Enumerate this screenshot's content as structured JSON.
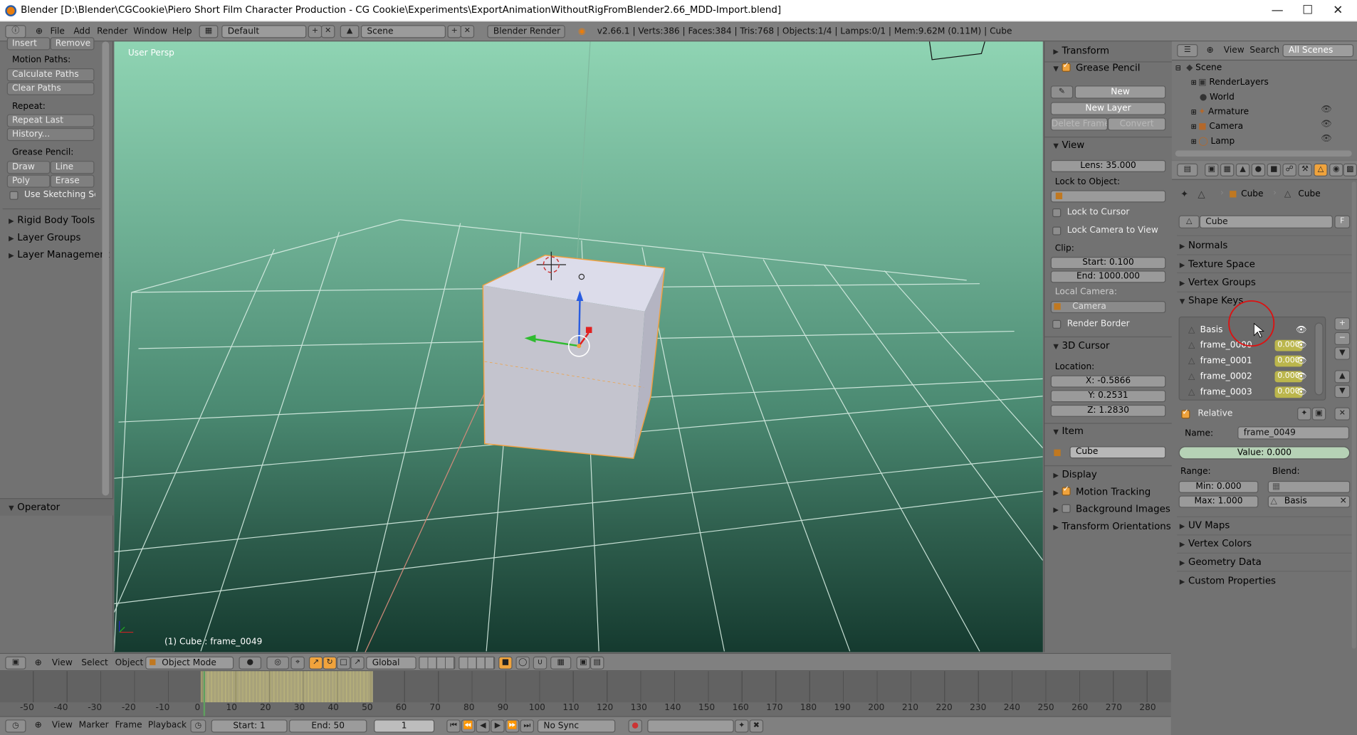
{
  "window": {
    "title": "Blender [D:\\Blender\\CGCookie\\Piero Short Film Character Production - CG Cookie\\Experiments\\ExportAnimationWithoutRigFromBlender2.66_MDD-Import.blend]"
  },
  "info_header": {
    "menus": [
      "File",
      "Add",
      "Render",
      "Window",
      "Help"
    ],
    "screen_layout": "Default",
    "scene": "Scene",
    "render_engine": "Blender Render",
    "stats": "v2.66.1 | Verts:386 | Faces:384 | Tris:768 | Objects:1/4 | Lamps:0/1 | Mem:9.62M (0.11M) | Cube"
  },
  "tool_shelf": {
    "top_buttons": [
      "Insert",
      "Remove"
    ],
    "motion_paths_label": "Motion Paths:",
    "motion_paths_buttons": [
      "Calculate Paths",
      "Clear Paths"
    ],
    "repeat_label": "Repeat:",
    "repeat_buttons": [
      "Repeat Last",
      "History..."
    ],
    "grease_pencil_label": "Grease Pencil:",
    "grease_pencil_buttons": [
      "Draw",
      "Line",
      "Poly",
      "Erase"
    ],
    "sketching_label": "Use Sketching Sessi",
    "collapsed_panels": [
      "Rigid Body Tools",
      "Layer Groups",
      "Layer Management"
    ],
    "operator_panel": "Operator"
  },
  "viewport": {
    "view_name": "User Persp",
    "object_info": "(1) Cube : frame_0049"
  },
  "n_panel": {
    "transform": "Transform",
    "grease_pencil": "Grease Pencil",
    "new_button": "New",
    "new_layer_button": "New Layer",
    "delete_frame_button": "Delete Frame",
    "convert_button": "Convert",
    "view": "View",
    "lens": "Lens: 35.000",
    "lock_to_object": "Lock to Object:",
    "lock_to_cursor": "Lock to Cursor",
    "lock_camera_to_view": "Lock Camera to View",
    "clip": "Clip:",
    "clip_start": "Start: 0.100",
    "clip_end": "End: 1000.000",
    "local_camera": "Local Camera:",
    "camera": "Camera",
    "render_border": "Render Border",
    "cursor3d": "3D Cursor",
    "location": "Location:",
    "x": "X: -0.5866",
    "y": "Y: 0.2531",
    "z": "Z: 1.2830",
    "item": "Item",
    "item_name": "Cube",
    "display": "Display",
    "motion_tracking": "Motion Tracking",
    "background_images": "Background Images",
    "transform_orientations": "Transform Orientations"
  },
  "outliner": {
    "menus": [
      "View",
      "Search"
    ],
    "filter": "All Scenes",
    "items": [
      "Scene",
      "RenderLayers",
      "World",
      "Armature",
      "Camera",
      "Lamp"
    ]
  },
  "properties": {
    "breadcrumb": [
      "Cube",
      "Cube"
    ],
    "mesh_name": "Cube",
    "fake_user": "F",
    "panels_top": [
      "Normals",
      "Texture Space",
      "Vertex Groups",
      "Shape Keys"
    ],
    "shape_keys": [
      {
        "name": "Basis",
        "value": ""
      },
      {
        "name": "frame_0000",
        "value": "0.000"
      },
      {
        "name": "frame_0001",
        "value": "0.000"
      },
      {
        "name": "frame_0002",
        "value": "0.000"
      },
      {
        "name": "frame_0003",
        "value": "0.000"
      }
    ],
    "relative": "Relative",
    "name_label": "Name:",
    "name_value": "frame_0049",
    "value": "Value: 0.000",
    "range_label": "Range:",
    "blend_label": "Blend:",
    "min": "Min: 0.000",
    "max": "Max: 1.000",
    "basis": "Basis",
    "panels_bottom": [
      "UV Maps",
      "Vertex Colors",
      "Geometry Data",
      "Custom Properties"
    ]
  },
  "view3d_header": {
    "menus": [
      "View",
      "Select",
      "Object"
    ],
    "mode": "Object Mode",
    "orientation": "Global"
  },
  "timeline": {
    "ticks": [
      "-50",
      "-40",
      "-30",
      "-20",
      "-10",
      "0",
      "10",
      "20",
      "30",
      "40",
      "50",
      "60",
      "70",
      "80",
      "90",
      "100",
      "110",
      "120",
      "130",
      "140",
      "150",
      "160",
      "170",
      "180",
      "190",
      "200",
      "210",
      "220",
      "230",
      "240",
      "250",
      "260",
      "270",
      "280"
    ]
  },
  "timeline_footer": {
    "menus": [
      "View",
      "Marker",
      "Frame",
      "Playback"
    ],
    "start": "Start: 1",
    "end": "End: 50",
    "current": "1",
    "sync": "No Sync"
  }
}
